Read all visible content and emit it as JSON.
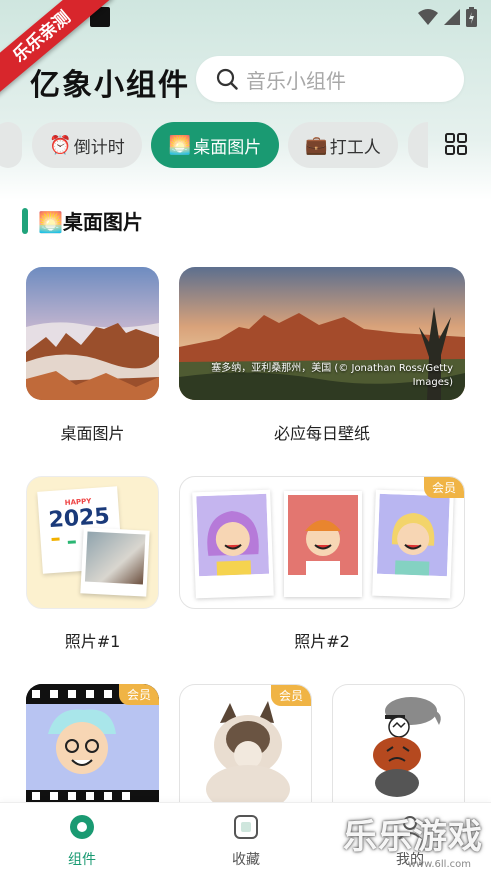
{
  "status_bar": {
    "ribbon": "乐乐亲测"
  },
  "header": {
    "app_title": "亿象小组件",
    "search_placeholder": "音乐小组件"
  },
  "tabs": [
    {
      "emoji": "⏰",
      "label": "倒计时"
    },
    {
      "emoji": "🌅",
      "label": "桌面图片",
      "active": true
    },
    {
      "emoji": "💼",
      "label": "打工人"
    }
  ],
  "section": {
    "emoji": "🌅",
    "title": "桌面图片"
  },
  "cards": {
    "desktop_photo": {
      "label": "桌面图片"
    },
    "bing_wallpaper": {
      "label": "必应每日壁纸",
      "caption": "塞多纳，亚利桑那州，美国 (© Jonathan Ross/Getty Images)"
    },
    "photo1": {
      "label": "照片#1",
      "year_text": "2025"
    },
    "photo2": {
      "label": "照片#2",
      "badge": "会员"
    },
    "film": {
      "badge": "会员"
    },
    "cat": {
      "badge": "会员"
    }
  },
  "bottom_nav": [
    {
      "label": "组件",
      "active": true
    },
    {
      "label": "收藏"
    },
    {
      "label": "我的"
    }
  ],
  "watermark": {
    "main": "乐乐游戏",
    "sub": "www.6ll.com"
  },
  "colors": {
    "accent": "#1a9a72",
    "badge": "#f0b445",
    "ribbon": "#d8262c"
  }
}
